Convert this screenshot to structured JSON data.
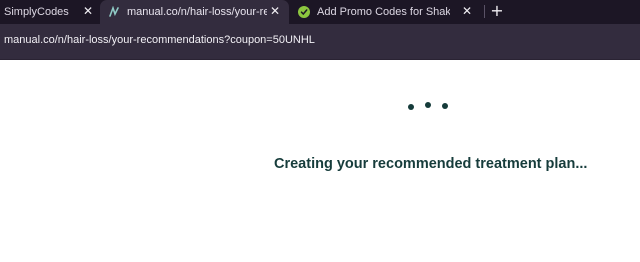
{
  "browser": {
    "tabs": [
      {
        "title": "SimplyCodes",
        "favicon": "none",
        "close_label": "✕",
        "active": false
      },
      {
        "title": "manual.co/n/hair-loss/your-rec",
        "favicon": "manual-logo-icon",
        "close_label": "✕",
        "active": true
      },
      {
        "title": "Add Promo Codes for Shaka Tin",
        "favicon": "simplycodes-icon",
        "close_label": "✕",
        "active": false
      }
    ],
    "new_tab_label": "+",
    "url": "manual.co/n/hair-loss/your-recommendations?coupon=50UNHL"
  },
  "page": {
    "loading_dots": 3,
    "loading_message": "Creating your recommended treatment plan..."
  },
  "colors": {
    "tabbar_bg": "#1c1625",
    "active_tab_bg": "#332c3e",
    "page_bg": "#ffffff",
    "brand_dark_green": "#163c3b",
    "simplycodes_green": "#8cc63f"
  }
}
